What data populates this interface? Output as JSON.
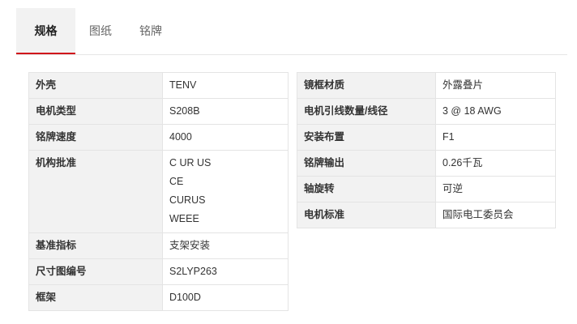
{
  "tabs": [
    {
      "label": "规格",
      "active": true
    },
    {
      "label": "图纸",
      "active": false
    },
    {
      "label": "铭牌",
      "active": false
    }
  ],
  "colors": {
    "accent": "#d0121b",
    "key_bg": "#f2f2f2",
    "border": "#e4e4e4"
  },
  "left_specs": [
    {
      "key": "外壳",
      "values": [
        "TENV"
      ]
    },
    {
      "key": "电机类型",
      "values": [
        "S208B"
      ]
    },
    {
      "key": "铭牌速度",
      "values": [
        "4000"
      ]
    },
    {
      "key": "机构批准",
      "values": [
        "C UR US",
        "CE",
        "CURUS",
        "WEEE"
      ]
    },
    {
      "key": "基准指标",
      "values": [
        "支架安装"
      ]
    },
    {
      "key": "尺寸图编号",
      "values": [
        "S2LYP263"
      ]
    },
    {
      "key": "框架",
      "values": [
        "D100D"
      ]
    }
  ],
  "right_specs": [
    {
      "key": "镜框材质",
      "values": [
        "外露叠片"
      ]
    },
    {
      "key": "电机引线数量/线径",
      "values": [
        "3 @ 18 AWG"
      ]
    },
    {
      "key": "安装布置",
      "values": [
        "F1"
      ]
    },
    {
      "key": "铭牌输出",
      "values": [
        "0.26千瓦"
      ]
    },
    {
      "key": "轴旋转",
      "values": [
        "可逆"
      ]
    },
    {
      "key": "电机标准",
      "values": [
        "国际电工委员会"
      ]
    }
  ]
}
